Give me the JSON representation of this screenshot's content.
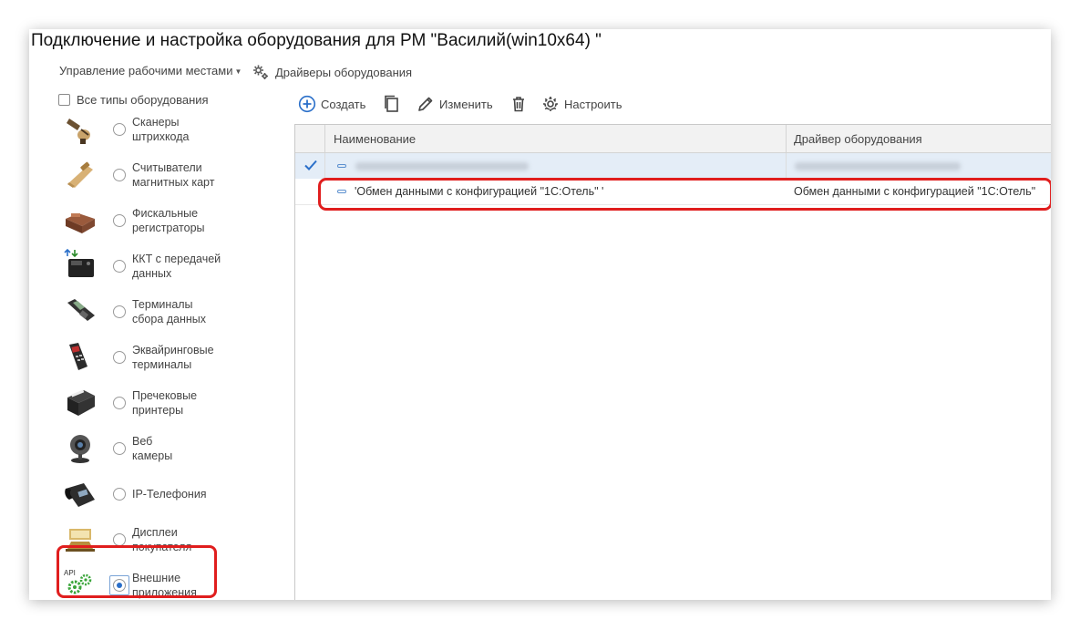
{
  "window": {
    "title": "Подключение и настройка оборудования для РМ \"Василий(win10x64) \""
  },
  "topbar": {
    "workplaces_menu": "Управление рабочими местами",
    "drivers_button": "Драйверы оборудования"
  },
  "filter": {
    "all_types_label": "Все типы оборудования",
    "all_types_checked": false
  },
  "equipment_types": [
    {
      "label_line1": "Сканеры",
      "label_line2": "штрихкода",
      "icon": "barcode-scanner-icon",
      "selected": false
    },
    {
      "label_line1": "Считыватели",
      "label_line2": "магнитных карт",
      "icon": "card-reader-icon",
      "selected": false
    },
    {
      "label_line1": "Фискальные",
      "label_line2": "регистраторы",
      "icon": "fiscal-registrar-icon",
      "selected": false
    },
    {
      "label_line1": "ККТ с передачей",
      "label_line2": "данных",
      "icon": "kkt-icon",
      "selected": false
    },
    {
      "label_line1": "Терминалы",
      "label_line2": "сбора данных",
      "icon": "data-terminal-icon",
      "selected": false
    },
    {
      "label_line1": "Эквайринговые",
      "label_line2": "терминалы",
      "icon": "acquiring-terminal-icon",
      "selected": false
    },
    {
      "label_line1": "Пречековые",
      "label_line2": "принтеры",
      "icon": "receipt-printer-icon",
      "selected": false
    },
    {
      "label_line1": "Веб",
      "label_line2": "камеры",
      "icon": "webcam-icon",
      "selected": false
    },
    {
      "label_line1": "IP-Телефония",
      "label_line2": "",
      "icon": "ip-phone-icon",
      "selected": false
    },
    {
      "label_line1": "Дисплеи",
      "label_line2": "покупателя",
      "icon": "customer-display-icon",
      "selected": false
    },
    {
      "label_line1": "Внешние",
      "label_line2": "приложения",
      "icon": "api-gears-icon",
      "selected": true
    }
  ],
  "toolbar": {
    "create": "Создать",
    "copy_icon": "copy-icon",
    "edit": "Изменить",
    "delete_icon": "trash-icon",
    "configure": "Настроить"
  },
  "table": {
    "columns": [
      "Наименование",
      "Драйвер оборудования"
    ],
    "rows": [
      {
        "name": "",
        "driver": "",
        "checked": true,
        "blurred": true
      },
      {
        "name": "'Обмен данными с конфигурацией \"1С:Отель\" '",
        "driver": "Обмен данными с конфигурацией \"1С:Отель\"",
        "checked": false,
        "blurred": false
      }
    ]
  },
  "colors": {
    "highlight": "#e01e1e",
    "accent": "#2a6fc9",
    "selected_row": "#e4edf7"
  }
}
